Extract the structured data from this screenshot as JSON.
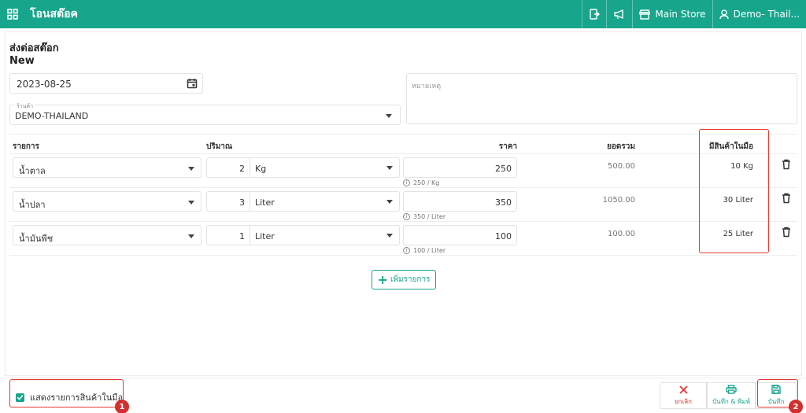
{
  "header": {
    "app_title": "โอนสต๊อค",
    "store": "Main Store",
    "user": "Demo- Thail..."
  },
  "page": {
    "title": "ส่งต่อสต๊อก",
    "status": "New"
  },
  "form": {
    "date": "2023-08-25",
    "shop_label": "ร้านค้า",
    "shop_value": "DEMO-THAILAND",
    "note_placeholder": "หมายเหตุ"
  },
  "table": {
    "headers": {
      "item": "รายการ",
      "qty": "ปริมาณ",
      "price": "ราคา",
      "total": "ยอดรวม",
      "onhand": "มีสินค้าในมือ"
    },
    "rows": [
      {
        "item": "น้ำตาล",
        "qty": "2",
        "unit": "Kg",
        "price": "250",
        "hint": "250 / Kg",
        "total": "500.00",
        "onhand": "10 Kg"
      },
      {
        "item": "น้ำปลา",
        "qty": "3",
        "unit": "Liter",
        "price": "350",
        "hint": "350 / Liter",
        "total": "1050.00",
        "onhand": "30 Liter"
      },
      {
        "item": "น้ำมันพืช",
        "qty": "1",
        "unit": "Liter",
        "price": "100",
        "hint": "100 / Liter",
        "total": "100.00",
        "onhand": "25 Liter"
      }
    ]
  },
  "add_item_label": "เพิ่มรายการ",
  "footer": {
    "show_onhand_label": "แสดงรายการสินค้าในมือ",
    "show_onhand_checked": true,
    "cancel_label": "ยกเลิก",
    "save_print_label": "บันทึก & พิมพ์",
    "save_label": "บันทึก"
  },
  "annotations": {
    "badge1": "1",
    "badge2": "2"
  },
  "colors": {
    "brand": "#17a58c",
    "danger": "#e53935",
    "annotation": "#d32f2f"
  }
}
